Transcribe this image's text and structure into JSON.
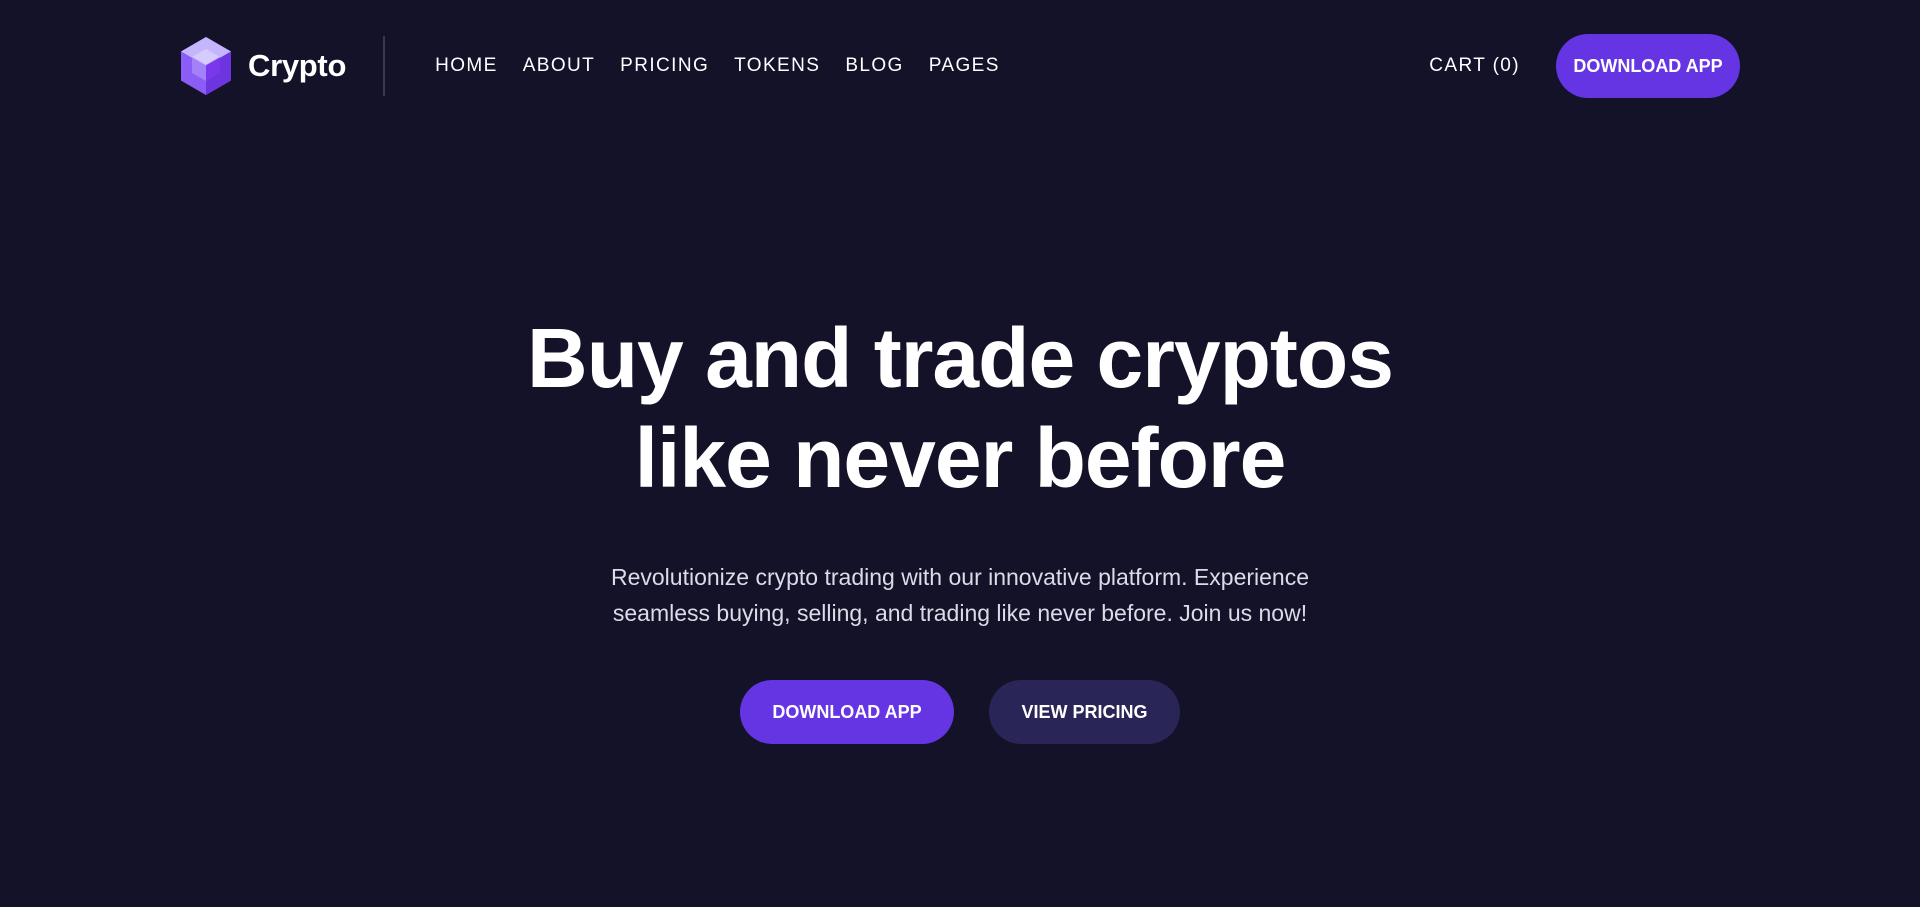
{
  "brand": {
    "name": "Crypto",
    "logo_icon": "hexagon-cube-logo-icon",
    "logo_colors": [
      "#a78bfa",
      "#8b5cf6",
      "#6d28d9"
    ]
  },
  "nav": {
    "items": [
      {
        "label": "HOME"
      },
      {
        "label": "ABOUT"
      },
      {
        "label": "PRICING"
      },
      {
        "label": "TOKENS"
      },
      {
        "label": "BLOG"
      },
      {
        "label": "PAGES"
      }
    ]
  },
  "header": {
    "cart_label": "CART (0)",
    "cta_label": "DOWNLOAD APP"
  },
  "hero": {
    "title_line1": "Buy and trade cryptos",
    "title_line2": "like never before",
    "subtitle_line1": "Revolutionize crypto trading with our innovative platform. Experience",
    "subtitle_line2": "seamless buying, selling, and trading like never before. Join us now!",
    "primary_button": "DOWNLOAD APP",
    "secondary_button": "VIEW PRICING"
  },
  "colors": {
    "background": "#131228",
    "accent": "#6535e3",
    "secondary_button": "#292557",
    "text": "#ffffff",
    "muted_text": "#dcdbe8"
  }
}
